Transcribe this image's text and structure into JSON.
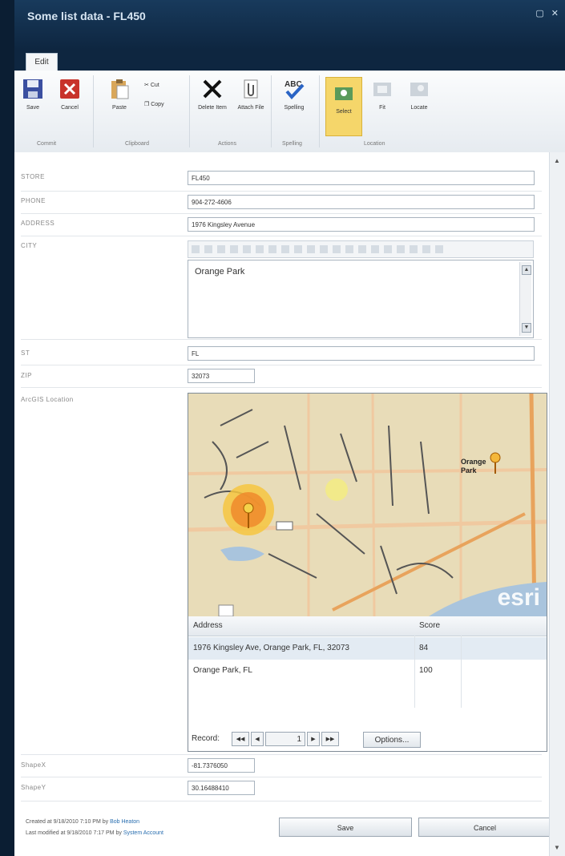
{
  "window": {
    "title": "Some list data - FL450",
    "controls": [
      "▢",
      "✕"
    ]
  },
  "ribbon": {
    "tab": "Edit",
    "buttons": {
      "save": "Save",
      "cancel": "Cancel",
      "paste": "Paste",
      "cut": "Cut",
      "copy": "Copy",
      "delete_item": "Delete Item",
      "attach_file": "Attach File",
      "spelling": "Spelling",
      "select": "Select",
      "fit": "Fit",
      "locate": "Locate"
    },
    "groups": {
      "commit": "Commit",
      "clipboard": "Clipboard",
      "actions": "Actions",
      "spelling": "Spelling",
      "location": "Location"
    }
  },
  "form": {
    "store": {
      "label": "STORE",
      "value": "FL450"
    },
    "phone": {
      "label": "PHONE",
      "value": "904-272-4606"
    },
    "address": {
      "label": "ADDRESS",
      "value": "1976 Kingsley Avenue"
    },
    "city": {
      "label": "CITY",
      "value": "Orange Park"
    },
    "st": {
      "label": "ST",
      "value": "FL"
    },
    "zip": {
      "label": "ZIP",
      "value": "32073"
    },
    "location": {
      "label": "ArcGIS Location"
    },
    "shapex": {
      "label": "ShapeX",
      "value": "-81.7376050"
    },
    "shapey": {
      "label": "ShapeY",
      "value": "30.16488410"
    }
  },
  "map": {
    "labels": {
      "orange_park": "Orange Park",
      "esri": "esri"
    },
    "grid": {
      "headers": [
        "Address",
        "Score"
      ],
      "rows": [
        {
          "address": "1976 Kingsley Ave, Orange Park, FL, 32073",
          "score": "84"
        },
        {
          "address": "Orange Park, FL",
          "score": "100"
        }
      ],
      "record_label": "Record:",
      "record_value": "1",
      "options_label": "Options..."
    }
  },
  "footer": {
    "created_prefix": "Created at 9/18/2010 7:10 PM by",
    "created_user": "Bob Heaton",
    "modified_prefix": "Last modified at 9/18/2010 7:17 PM by",
    "modified_user": "System Account",
    "save_label": "Save",
    "cancel_label": "Cancel"
  },
  "colors": {
    "title_bg": "#0e2640",
    "select_highlight": "#f5d66a",
    "link": "#2a6fb0",
    "map_bg": "#e8dcb8"
  }
}
